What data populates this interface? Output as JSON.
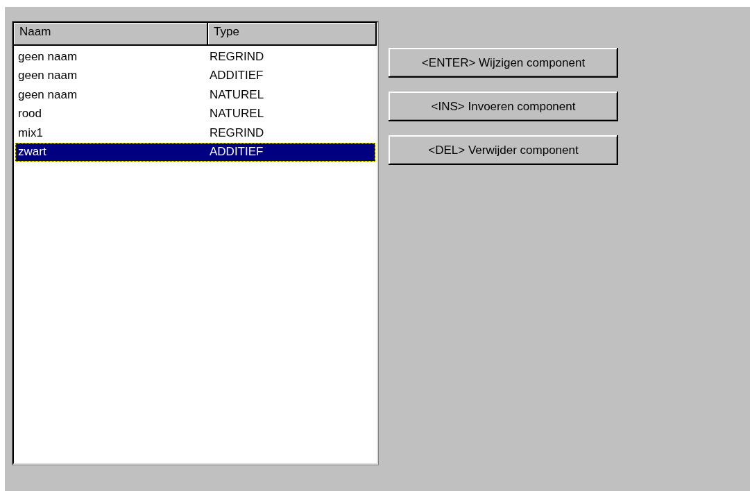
{
  "list": {
    "columns": [
      "Naam",
      "Type"
    ],
    "rows": [
      {
        "cells": [
          "geen naam",
          "REGRIND"
        ],
        "selected": false
      },
      {
        "cells": [
          "geen naam",
          "ADDITIEF"
        ],
        "selected": false
      },
      {
        "cells": [
          "geen naam",
          "NATUREL"
        ],
        "selected": false
      },
      {
        "cells": [
          "rood",
          "NATUREL"
        ],
        "selected": false
      },
      {
        "cells": [
          "mix1",
          "REGRIND"
        ],
        "selected": false
      },
      {
        "cells": [
          "zwart",
          "ADDITIEF"
        ],
        "selected": true
      }
    ]
  },
  "buttons": [
    "<ENTER> Wijzigen component",
    "<INS> Invoeren component",
    "<DEL> Verwijder component"
  ]
}
